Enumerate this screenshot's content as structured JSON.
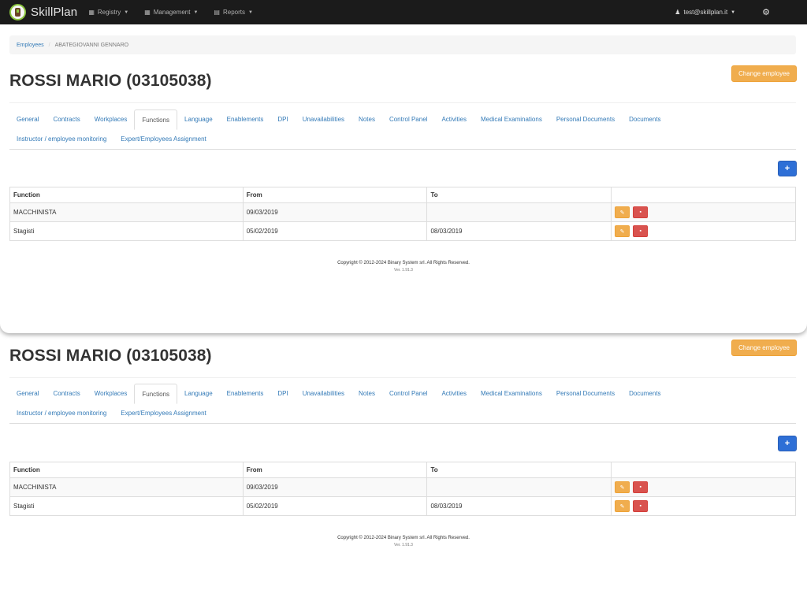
{
  "navbar": {
    "brand": "SkillPlan",
    "menus": [
      {
        "label": "Registry",
        "icon": "calendar-icon"
      },
      {
        "label": "Management",
        "icon": "calendar-icon"
      },
      {
        "label": "Reports",
        "icon": "document-icon"
      }
    ],
    "user": "test@skillplan.it",
    "user_icon": "user-icon",
    "settings_icon": "gear-icon"
  },
  "breadcrumb": {
    "root": "Employees",
    "separator": "/",
    "current": "ABATEGIOVANNI GENNARO"
  },
  "page": {
    "title": "ROSSI MARIO (03105038)",
    "change_employee_label": "Change employee",
    "add_label": "+"
  },
  "tabs": {
    "row1": [
      "General",
      "Contracts",
      "Workplaces",
      "Functions",
      "Language",
      "Enablements",
      "DPI",
      "Unavailabilities",
      "Notes",
      "Control Panel",
      "Activities",
      "Medical Examinations",
      "Personal Documents",
      "Documents"
    ],
    "row2": [
      "Instructor / employee monitoring",
      "Expert/Employees Assignment"
    ],
    "active": "Functions"
  },
  "table": {
    "headers": [
      "Function",
      "From",
      "To",
      ""
    ],
    "rows": [
      {
        "function": "MACCHINISTA",
        "from": "09/03/2019",
        "to": ""
      },
      {
        "function": "Stagisti",
        "from": "05/02/2019",
        "to": "08/03/2019"
      }
    ]
  },
  "footer": {
    "copyright": "Copyright © 2012-2024 Binary System srl. All Rights Reserved.",
    "version": "Ver. 1.91.3"
  },
  "colors": {
    "navbar": "#1b1b1b",
    "link": "#337ab7",
    "warning": "#f0ad4e",
    "danger": "#d9534f",
    "primary": "#2e6fd6"
  }
}
